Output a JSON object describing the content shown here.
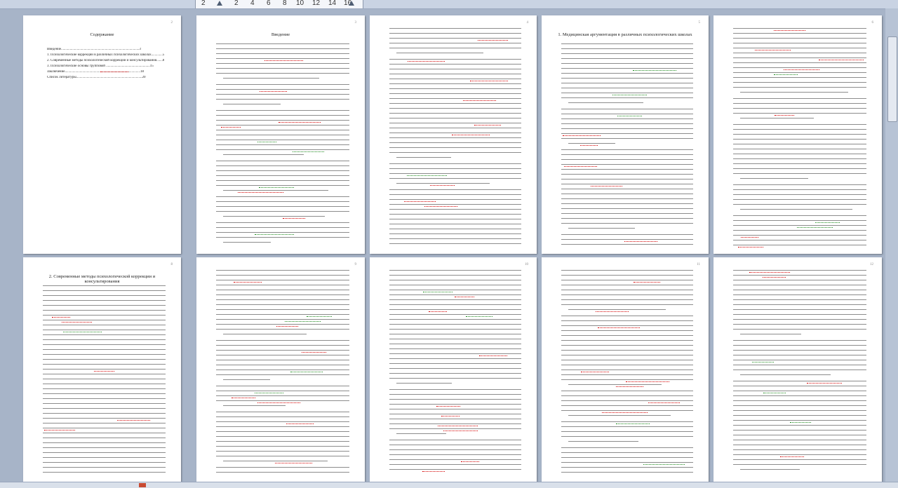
{
  "ruler": {
    "numbers": [
      "2",
      "2",
      "4",
      "6",
      "8",
      "10",
      "12",
      "14",
      "16"
    ]
  },
  "pages": [
    {
      "title": "Содержание",
      "page_number": "2"
    },
    {
      "title": "Введение",
      "page_number": "3"
    },
    {
      "title": "",
      "page_number": "4"
    },
    {
      "title": "1. Медицинская аргументация в различных психологических школах",
      "page_number": "5"
    },
    {
      "title": "",
      "page_number": "6"
    },
    {
      "title": "2. Современные методы психологической коррекции и консультирования",
      "page_number": "8"
    },
    {
      "title": "",
      "page_number": "9"
    },
    {
      "title": "",
      "page_number": "10"
    },
    {
      "title": "",
      "page_number": "11"
    },
    {
      "title": "",
      "page_number": "12"
    }
  ],
  "toc": [
    "Введение.........................................................................................3",
    "1. Психологические коррекции в различных психологических школах.............5",
    "2. Современные методы психологической коррекции и консультирования.......8",
    "3. Психологические основы групповой ..................................................15",
    "Заключение......................................................................................18",
    "Список литературы...........................................................................20"
  ],
  "colors": {
    "spelling_underline": "#d40000",
    "grammar_underline": "#1e8a1e",
    "workspace": "#a7b4c8"
  }
}
